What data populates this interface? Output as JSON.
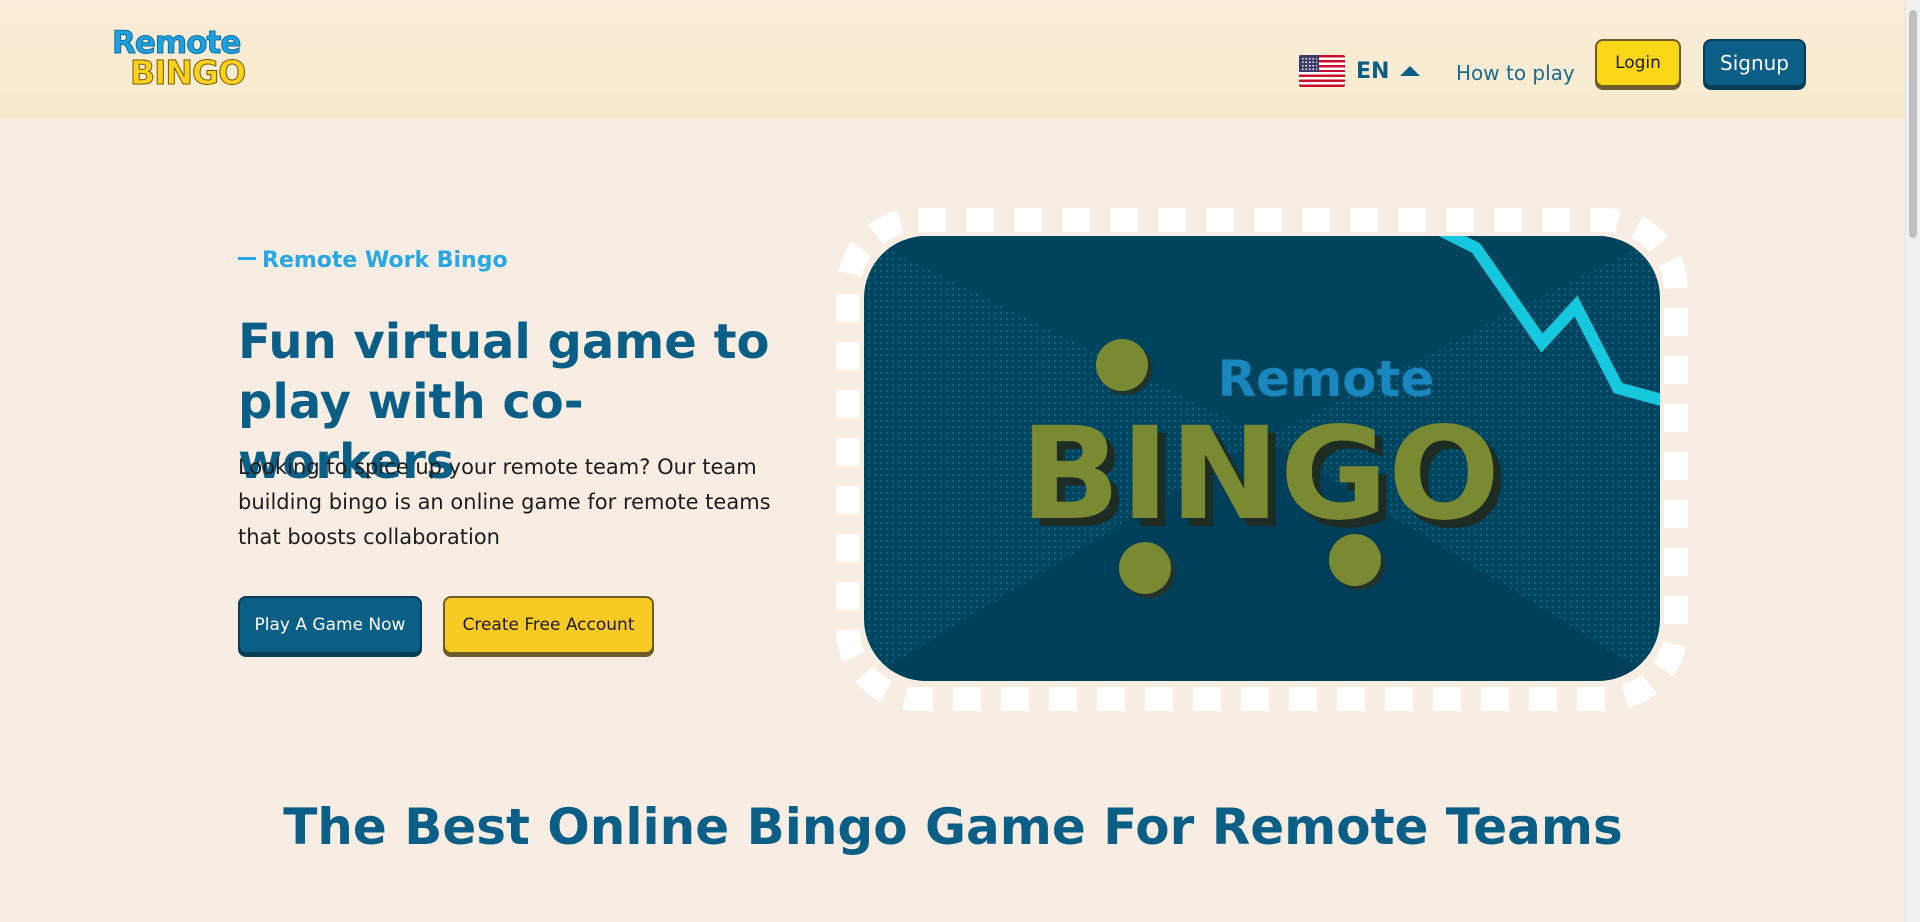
{
  "header": {
    "logo": {
      "line1": "Remote",
      "line2": "BINGO"
    },
    "language": {
      "label": "EN",
      "flag_icon": "us-flag-icon"
    },
    "nav": {
      "how_to_play": "How to play"
    },
    "login_label": "Login",
    "signup_label": "Signup"
  },
  "hero": {
    "eyebrow": "Remote Work Bingo",
    "title": "Fun virtual game to play with co-workers",
    "description": "Looking to spice up your remote team? Our team building bingo is an online game for remote teams that boosts collaboration",
    "primary_cta": "Play A Game Now",
    "secondary_cta": "Create Free Account",
    "image": {
      "word_top": "Remote",
      "word_main": "BINGO"
    }
  },
  "section": {
    "title": "The Best Online Bingo Game For Remote Teams"
  },
  "colors": {
    "background": "#f7ede3",
    "brand_blue": "#0b5e86",
    "accent_yellow": "#fbd817",
    "eyebrow_blue": "#28a7e3",
    "art_dark": "#004560",
    "art_olive": "#7a8a32",
    "art_cyan": "#16c8de"
  }
}
